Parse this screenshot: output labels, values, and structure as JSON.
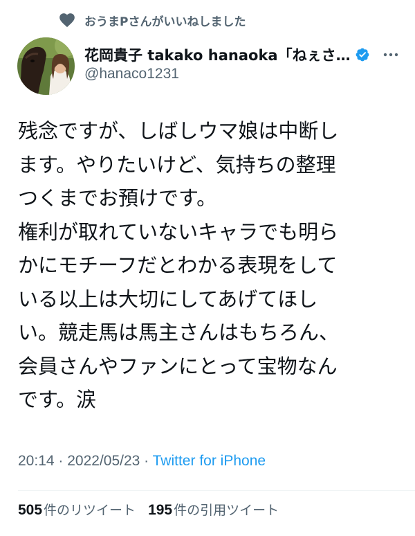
{
  "social_context": {
    "text": "おうまPさんがいいねしました",
    "icon": "heart-icon"
  },
  "author": {
    "display_name": "花岡貴子 takako hanaoka「ねぇさ…",
    "handle": "@hanaco1231",
    "verified": true
  },
  "tweet": {
    "text": "残念ですが、しばしウマ娘は中断し\nます。やりたいけど、気持ちの整理\nつくまでお預けです。\n権利が取れていないキャラでも明ら\nかにモチーフだとわかる表現をして\nいる以上は大切にしてあげてほし\nい。競走馬は馬主さんはもちろん、\n会員さんやファンにとって宝物なん\nです。涙"
  },
  "meta": {
    "time": "20:14",
    "separator": " · ",
    "date": "2022/05/23",
    "source": "Twitter for iPhone"
  },
  "stats": {
    "retweets_count": "505",
    "retweets_label": "件のリツイート",
    "quotes_count": "195",
    "quotes_label": "件の引用ツイート"
  },
  "colors": {
    "secondary_text": "#536471",
    "link": "#1d9bf0",
    "primary_text": "#0f1419"
  }
}
